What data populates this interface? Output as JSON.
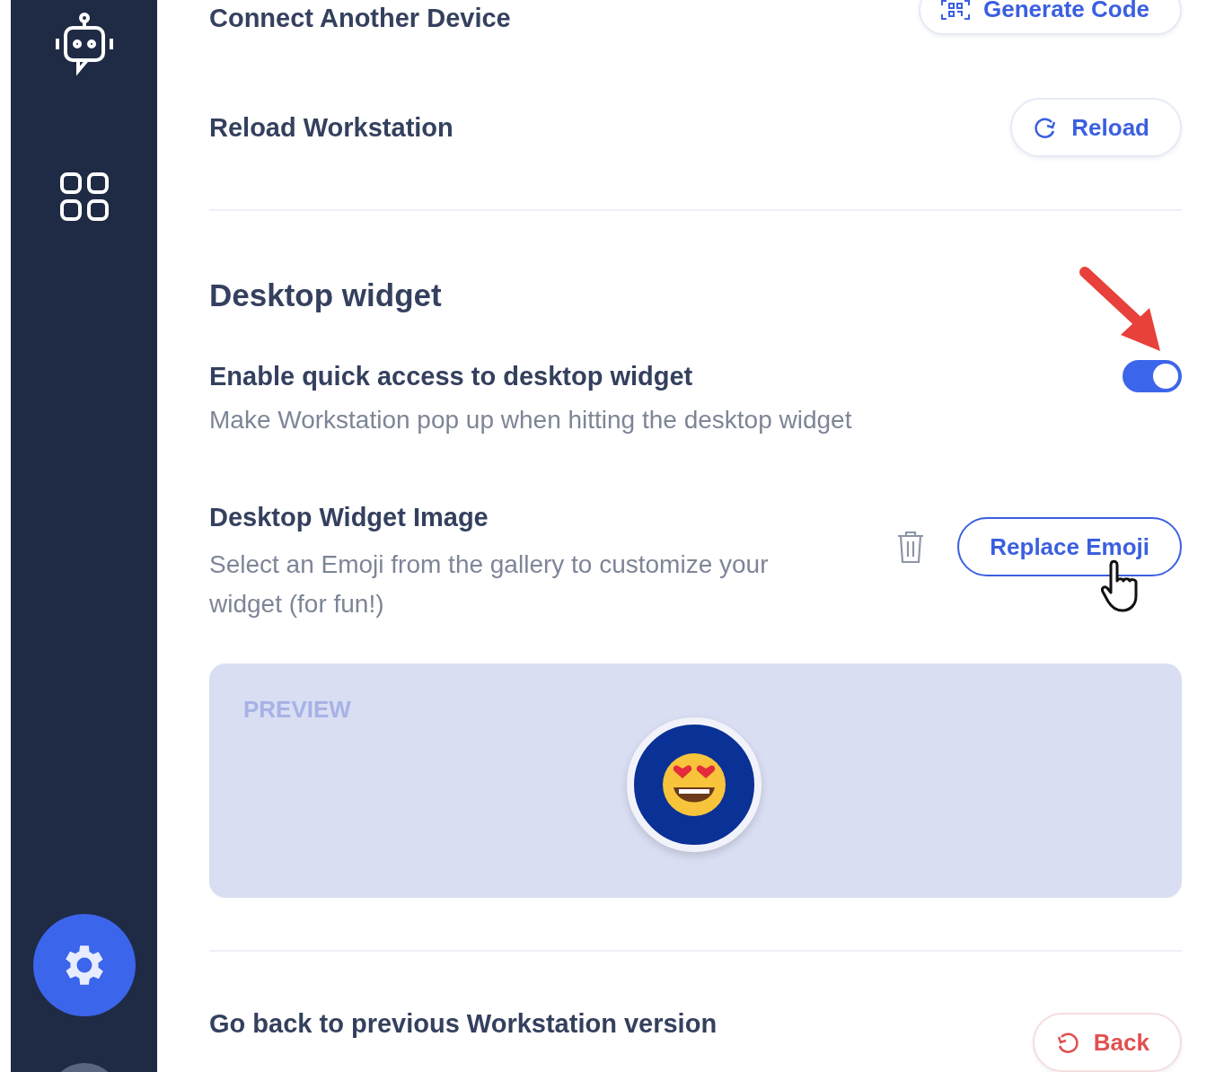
{
  "sidebar": {
    "items": [
      {
        "kind": "bot",
        "selected": false
      },
      {
        "kind": "apps",
        "selected": false
      },
      {
        "kind": "settings",
        "selected": true
      },
      {
        "kind": "avatar",
        "selected": false
      }
    ]
  },
  "connect": {
    "title": "Connect Another Device",
    "button": "Generate Code"
  },
  "reload": {
    "title": "Reload Workstation",
    "button": "Reload"
  },
  "widget": {
    "heading": "Desktop widget",
    "quick_access": {
      "title": "Enable quick access to desktop widget",
      "description": "Make Workstation pop up when hitting the desktop widget",
      "on": true
    },
    "image": {
      "title": "Desktop Widget Image",
      "description": "Select an Emoji from the gallery to customize your widget (for fun!)",
      "button": "Replace Emoji"
    },
    "preview": {
      "label": "PREVIEW"
    }
  },
  "version": {
    "title": "Go back to previous Workstation version",
    "button": "Back"
  }
}
